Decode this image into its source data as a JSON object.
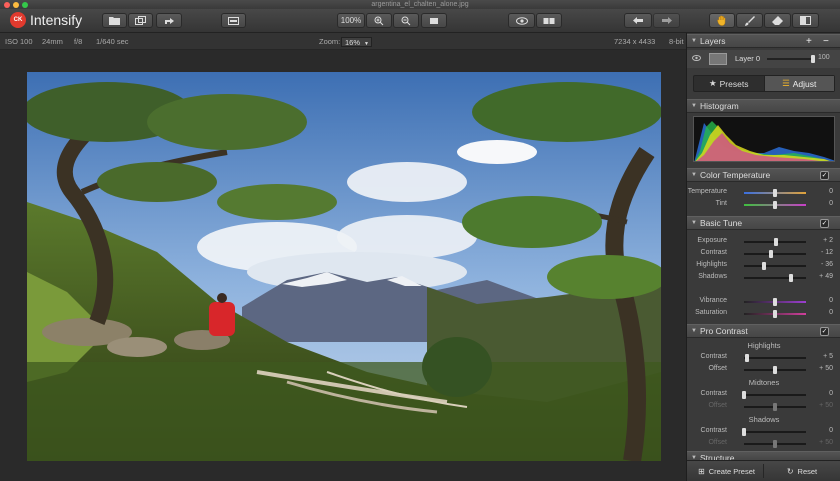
{
  "window": {
    "title": "argentina_el_chalten_alone.jpg"
  },
  "app": {
    "name": "Intensify",
    "logo_text": "CK"
  },
  "toolbar": {
    "zoom_level": "100%",
    "open_icon": "folder-icon",
    "compare_icon": "eye-icon"
  },
  "infobar": {
    "iso": "ISO 100",
    "focal": "24mm",
    "aperture": "f/8",
    "shutter": "1/640 sec",
    "zoom_label": "Zoom:",
    "zoom_value": "16%",
    "dimensions": "7234 x 4433",
    "bitdepth": "8-bit"
  },
  "panel": {
    "layers": {
      "title": "Layers",
      "layer_name": "Layer 0",
      "opacity": "100"
    },
    "tabs": {
      "presets": "Presets",
      "adjust": "Adjust"
    },
    "histogram": {
      "title": "Histogram"
    },
    "color_temperature": {
      "title": "Color Temperature",
      "rows": [
        {
          "label": "Temperature",
          "value": "0",
          "level": 0.5
        },
        {
          "label": "Tint",
          "value": "0",
          "level": 0.5
        }
      ]
    },
    "basic_tune": {
      "title": "Basic Tune",
      "rows": [
        {
          "label": "Exposure",
          "value": "+ 2",
          "level": 0.52
        },
        {
          "label": "Contrast",
          "value": "- 12",
          "level": 0.44
        },
        {
          "label": "Highlights",
          "value": "- 36",
          "level": 0.32
        },
        {
          "label": "Shadows",
          "value": "+ 49",
          "level": 0.75
        }
      ],
      "rows2": [
        {
          "label": "Vibrance",
          "value": "0",
          "level": 0.5
        },
        {
          "label": "Saturation",
          "value": "0",
          "level": 0.5
        }
      ]
    },
    "pro_contrast": {
      "title": "Pro Contrast",
      "groups": [
        {
          "heading": "Highlights",
          "rows": [
            {
              "label": "Contrast",
              "value": "+ 5",
              "level": 0.05,
              "dim": false
            },
            {
              "label": "Offset",
              "value": "+ 50",
              "level": 0.5,
              "dim": false
            }
          ]
        },
        {
          "heading": "Midtones",
          "rows": [
            {
              "label": "Contrast",
              "value": "0",
              "level": 0.0,
              "dim": false
            },
            {
              "label": "Offset",
              "value": "+ 50",
              "level": 0.5,
              "dim": true
            }
          ]
        },
        {
          "heading": "Shadows",
          "rows": [
            {
              "label": "Contrast",
              "value": "0",
              "level": 0.0,
              "dim": false
            },
            {
              "label": "Offset",
              "value": "+ 50",
              "level": 0.5,
              "dim": true
            }
          ]
        }
      ]
    },
    "structure": {
      "title": "Structure"
    },
    "footer": {
      "create_preset": "Create Preset",
      "reset": "Reset"
    }
  },
  "colors": {
    "accent_red": "#e13a2e",
    "panel_bg": "#3a3a3a",
    "active_tab": "#555555"
  }
}
